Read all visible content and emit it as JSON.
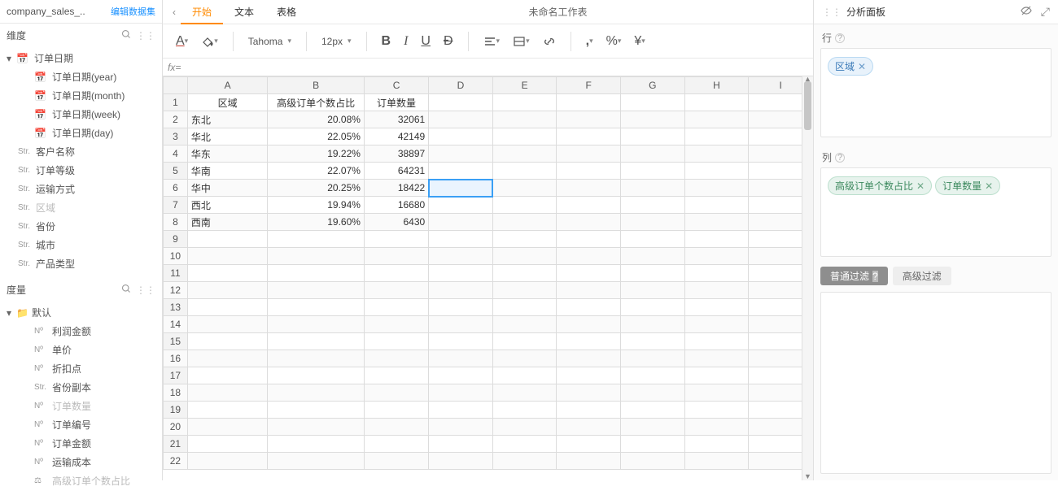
{
  "dataset": {
    "name": "company_sales_..",
    "edit_link": "编辑数据集"
  },
  "sidebar": {
    "dim_label": "维度",
    "measure_label": "度量",
    "dimensions": {
      "date_group": "订单日期",
      "date_children": [
        "订单日期(year)",
        "订单日期(month)",
        "订单日期(week)",
        "订单日期(day)"
      ],
      "strs": [
        {
          "label": "客户名称",
          "dim": false
        },
        {
          "label": "订单等级",
          "dim": false
        },
        {
          "label": "运输方式",
          "dim": false
        },
        {
          "label": "区域",
          "dim": true
        },
        {
          "label": "省份",
          "dim": false
        },
        {
          "label": "城市",
          "dim": false
        },
        {
          "label": "产品类型",
          "dim": false
        }
      ]
    },
    "measures": {
      "default_folder": "默认",
      "items": [
        {
          "t": "Nº",
          "label": "利润金额",
          "dim": false
        },
        {
          "t": "Nº",
          "label": "单价",
          "dim": false
        },
        {
          "t": "Nº",
          "label": "折扣点",
          "dim": false
        },
        {
          "t": "Str.",
          "label": "省份副本",
          "dim": false
        },
        {
          "t": "Nº",
          "label": "订单数量",
          "dim": true
        },
        {
          "t": "Nº",
          "label": "订单编号",
          "dim": false
        },
        {
          "t": "Nº",
          "label": "订单金额",
          "dim": false
        },
        {
          "t": "Nº",
          "label": "运输成本",
          "dim": false
        },
        {
          "t": "fx",
          "label": "高级订单个数占比",
          "dim": true
        }
      ]
    }
  },
  "tabs": {
    "start": "开始",
    "text": "文本",
    "table": "表格"
  },
  "sheet_title": "未命名工作表",
  "toolbar": {
    "font": "Tahoma",
    "size": "12px"
  },
  "fx_label": "fx",
  "grid": {
    "cols": [
      "A",
      "B",
      "C",
      "D",
      "E",
      "F",
      "G",
      "H",
      "I"
    ],
    "headers": [
      "区域",
      "高级订单个数占比",
      "订单数量"
    ],
    "rows": [
      {
        "a": "东北",
        "b": "20.08%",
        "c": "32061"
      },
      {
        "a": "华北",
        "b": "22.05%",
        "c": "42149"
      },
      {
        "a": "华东",
        "b": "19.22%",
        "c": "38897"
      },
      {
        "a": "华南",
        "b": "22.07%",
        "c": "64231"
      },
      {
        "a": "华中",
        "b": "20.25%",
        "c": "18422"
      },
      {
        "a": "西北",
        "b": "19.94%",
        "c": "16680"
      },
      {
        "a": "西南",
        "b": "19.60%",
        "c": "6430"
      }
    ],
    "empty_rows": 22,
    "selected": {
      "row": 6,
      "col": "D"
    }
  },
  "panel": {
    "title": "分析面板",
    "row_label": "行",
    "col_label": "列",
    "row_pills": [
      "区域"
    ],
    "col_pills": [
      "高级订单个数占比",
      "订单数量"
    ],
    "filter_tabs": {
      "basic": "普通过滤",
      "advanced": "高级过滤"
    }
  }
}
